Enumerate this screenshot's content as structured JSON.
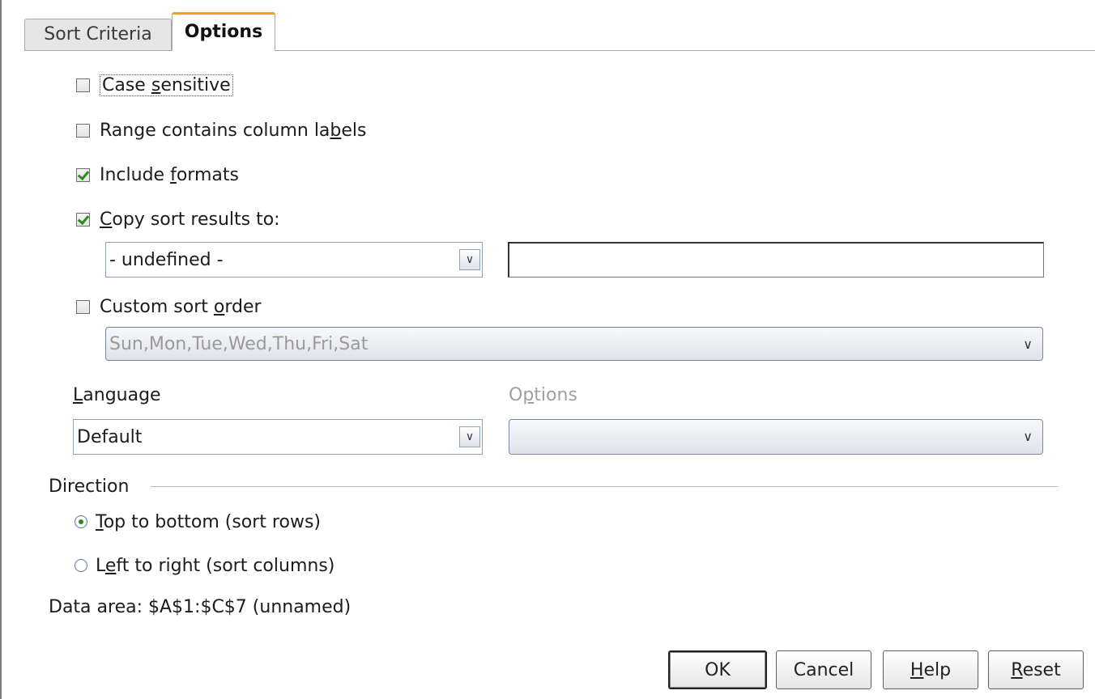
{
  "tabs": {
    "sort_criteria": "Sort Criteria",
    "options": "Options"
  },
  "checkboxes": {
    "case_sensitive": {
      "pre": "Case ",
      "key": "s",
      "post": "ensitive",
      "checked": false
    },
    "column_labels": {
      "pre": "Range contains column la",
      "key": "b",
      "post": "els",
      "checked": false
    },
    "include_formats": {
      "pre": "Include ",
      "key": "f",
      "post": "ormats",
      "checked": true
    },
    "copy_results": {
      "pre": "",
      "key": "C",
      "post": "opy sort results to:",
      "checked": true
    },
    "custom_order": {
      "pre": "Custom sort ",
      "key": "o",
      "post": "rder",
      "checked": false
    }
  },
  "copy_target": {
    "selected": "- undefined -",
    "text_value": ""
  },
  "custom_order_select": {
    "selected": "Sun,Mon,Tue,Wed,Thu,Fri,Sat"
  },
  "language": {
    "label_key": "L",
    "label_post": "anguage",
    "selected": "Default"
  },
  "options_select": {
    "label_pre": "O",
    "label_key": "p",
    "label_post": "tions",
    "selected": ""
  },
  "direction": {
    "title": "Direction",
    "top_to_bottom": {
      "key": "T",
      "post": "op to bottom (sort rows)",
      "selected": true
    },
    "left_to_right": {
      "pre": "L",
      "key": "e",
      "post": "ft to right (sort columns)",
      "selected": false
    }
  },
  "data_area": "Data area: $A$1:$C$7 (unnamed)",
  "buttons": {
    "ok": "OK",
    "cancel": "Cancel",
    "help_key": "H",
    "help_post": "elp",
    "reset_key": "R",
    "reset_post": "eset"
  },
  "icons": {
    "dropdown": "chevron-down-icon",
    "checkmark": "checkmark-icon",
    "radio_dot": "radio-dot-icon"
  },
  "colors": {
    "accent_tab": "#f0a020",
    "check_green": "#2c8a1e",
    "field_border": "#8fa2b8"
  }
}
